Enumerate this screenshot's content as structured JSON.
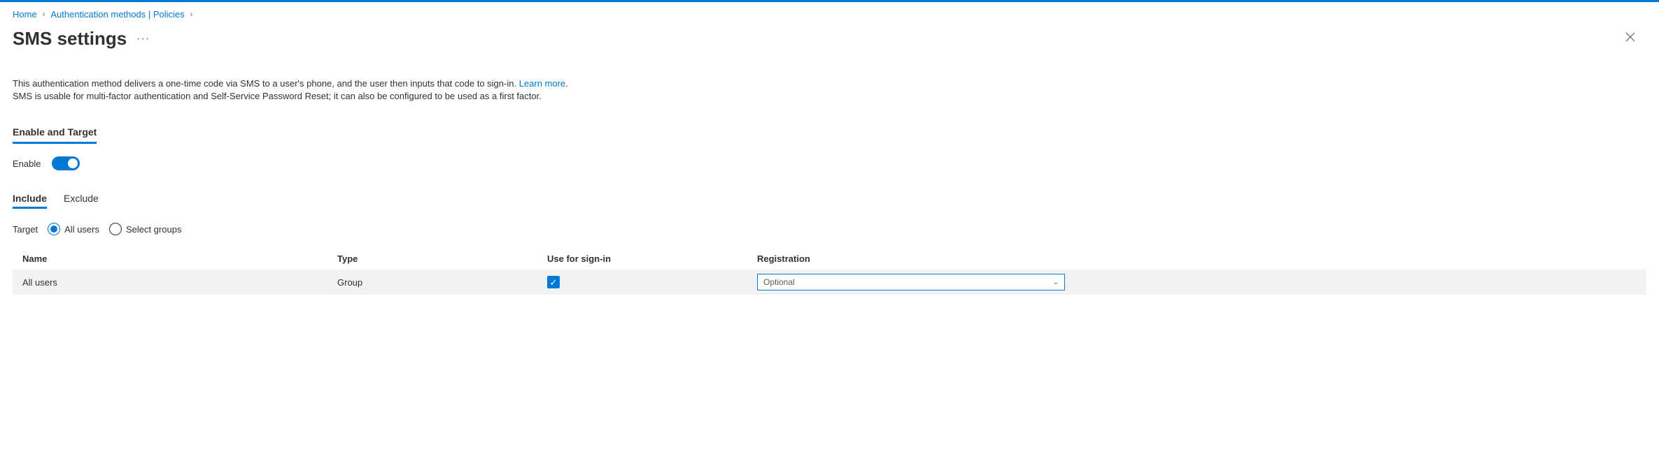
{
  "breadcrumb": {
    "home": "Home",
    "policies": "Authentication methods | Policies"
  },
  "header": {
    "title": "SMS settings"
  },
  "description": {
    "line1a": "This authentication method delivers a one-time code via SMS to a user's phone, and the user then inputs that code to sign-in. ",
    "learn_more": "Learn more",
    "line1b": ".",
    "line2": "SMS is usable for multi-factor authentication and Self-Service Password Reset; it can also be configured to be used as a first factor."
  },
  "sections": {
    "enable_and_target": "Enable and Target"
  },
  "enable": {
    "label": "Enable"
  },
  "tabs": {
    "include": "Include",
    "exclude": "Exclude"
  },
  "target": {
    "label": "Target",
    "all_users": "All users",
    "select_groups": "Select groups"
  },
  "grid": {
    "headers": {
      "name": "Name",
      "type": "Type",
      "signin": "Use for sign-in",
      "registration": "Registration"
    },
    "row": {
      "name": "All users",
      "type": "Group",
      "registration": "Optional"
    }
  }
}
